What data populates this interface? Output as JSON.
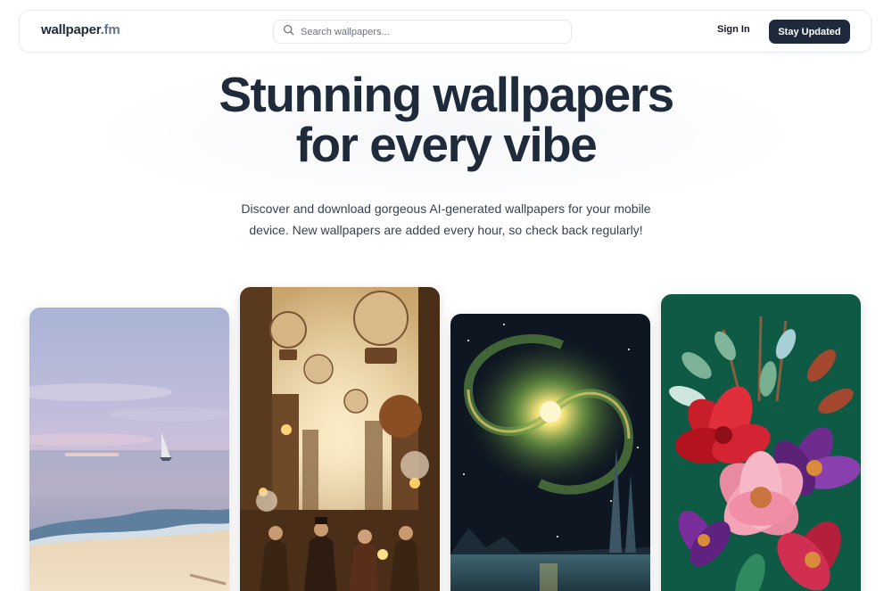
{
  "brand": {
    "name": "wallpaper",
    "tld": ".fm"
  },
  "search": {
    "placeholder": "Search wallpapers..."
  },
  "nav": {
    "signin_label": "Sign In",
    "cta_label": "Stay Updated"
  },
  "hero": {
    "headline_line1": "Stunning wallpapers",
    "headline_line2": "for every vibe",
    "subtitle": "Discover and download gorgeous AI-generated wallpapers for your mobile device. New wallpapers are added every hour, so check back regularly!"
  },
  "colors": {
    "cta_bg": "#1e2a3b",
    "headline": "#1f2a3a"
  },
  "icons": {
    "search": "search-icon"
  },
  "wallpapers": [
    {
      "subject": "ocean beach with sailboat at sunset"
    },
    {
      "subject": "steampunk market with hot air balloons"
    },
    {
      "subject": "spiral galaxy over lake with spires"
    },
    {
      "subject": "paper craft flowers on green"
    }
  ]
}
